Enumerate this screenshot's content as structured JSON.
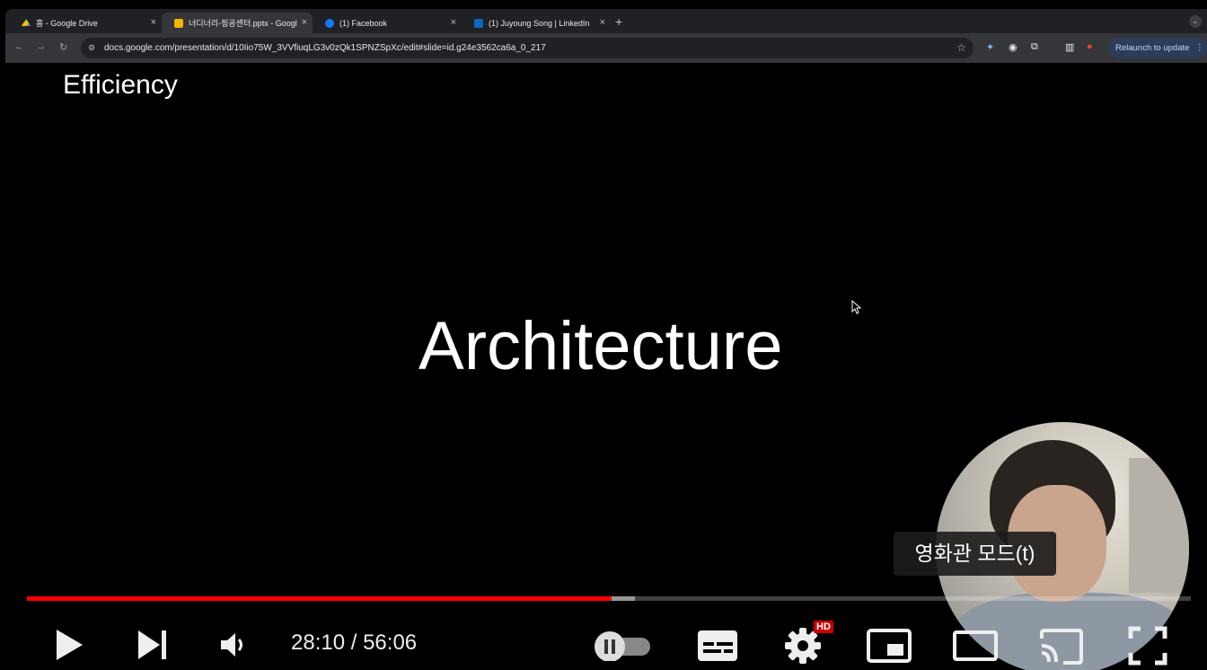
{
  "browser": {
    "tabs": [
      {
        "title": "홈 - Google Drive",
        "favicon": "google-drive-icon",
        "active": false
      },
      {
        "title": "너디너리-핑공센터.pptx - Googl",
        "favicon": "google-slides-icon",
        "active": true
      },
      {
        "title": "(1) Facebook",
        "favicon": "facebook-icon",
        "active": false
      },
      {
        "title": "(1) Juyoung Song | LinkedIn",
        "favicon": "linkedin-icon",
        "active": false
      }
    ],
    "url": "docs.google.com/presentation/d/10Iio75W_3VVfiuqLG3v0zQk1SPNZSpXc/edit#slide=id.g24e3562ca6a_0_217",
    "relaunch_label": "Relaunch to update"
  },
  "slide": {
    "heading": "Efficiency",
    "title": "Architecture"
  },
  "player": {
    "tooltip": "영화관 모드(t)",
    "current_time": "28:10",
    "separator": " / ",
    "duration": "56:06",
    "time_display": "28:10 / 56:06",
    "progress_fraction": 0.502,
    "buffered_fraction": 0.522,
    "quality_badge": "HD",
    "accent": "#ff0000"
  }
}
